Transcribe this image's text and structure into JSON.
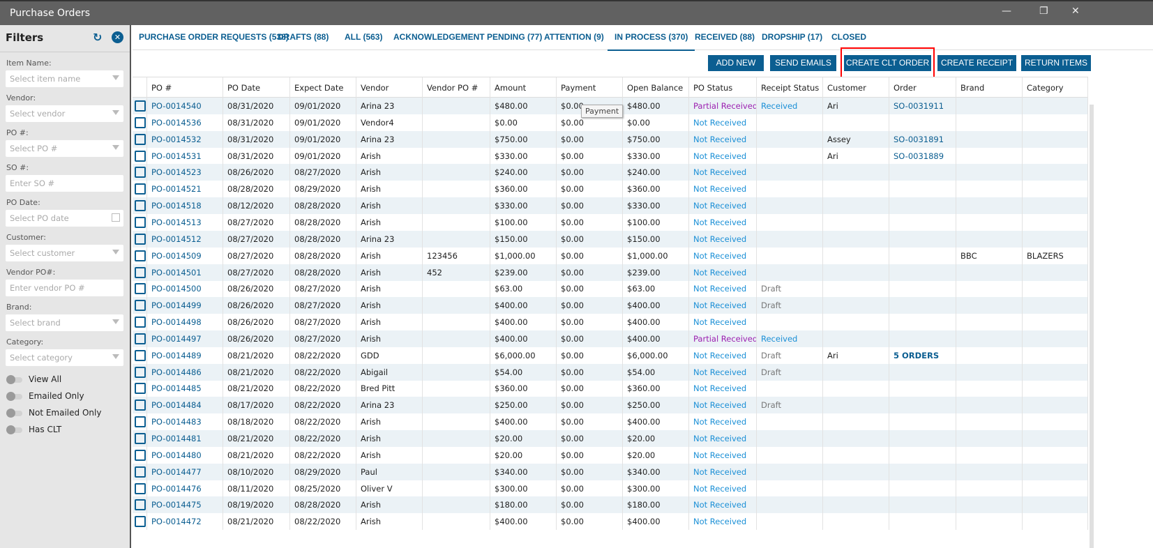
{
  "window": {
    "title": "Purchase Orders",
    "minimize": "—",
    "restore": "❐",
    "close": "✕"
  },
  "filters": {
    "title": "Filters",
    "refresh_icon": "↻",
    "clear_icon": "✕",
    "fields": [
      {
        "label": "Item Name:",
        "placeholder": "Select item name",
        "kind": "select"
      },
      {
        "label": "Vendor:",
        "placeholder": "Select vendor",
        "kind": "select"
      },
      {
        "label": "PO #:",
        "placeholder": "Select PO #",
        "kind": "select"
      },
      {
        "label": "SO #:",
        "placeholder": "Enter SO #",
        "kind": "text"
      },
      {
        "label": "PO Date:",
        "placeholder": "Select PO date",
        "kind": "date"
      },
      {
        "label": "Customer:",
        "placeholder": "Select customer",
        "kind": "select"
      },
      {
        "label": "Vendor PO#:",
        "placeholder": "Enter vendor PO #",
        "kind": "text"
      },
      {
        "label": "Brand:",
        "placeholder": "Select brand",
        "kind": "select"
      },
      {
        "label": "Category:",
        "placeholder": "Select category",
        "kind": "select"
      }
    ],
    "toggles": [
      "View All",
      "Emailed Only",
      "Not Emailed Only",
      "Has CLT"
    ]
  },
  "tabs": [
    "PURCHASE ORDER REQUESTS (538)",
    "DRAFTS (88)",
    "ALL (563)",
    "ACKNOWLEDGEMENT PENDING (77)",
    "ATTENTION (9)",
    "IN PROCESS (370)",
    "RECEIVED (88)",
    "DROPSHIP (17)",
    "CLOSED"
  ],
  "active_tab": 5,
  "buttons": [
    "ADD NEW",
    "SEND EMAILS",
    "CREATE CLT ORDER",
    "CREATE RECEIPT",
    "RETURN ITEMS"
  ],
  "tooltip": "Payment",
  "columns": [
    "PO #",
    "PO Date",
    "Expect Date",
    "Vendor",
    "Vendor PO #",
    "Amount",
    "Payment",
    "Open Balance",
    "PO Status",
    "Receipt Status",
    "Customer",
    "Order",
    "Brand",
    "Category"
  ],
  "rows": [
    [
      "PO-0014540",
      "08/31/2020",
      "09/01/2020",
      "Arina 23",
      "",
      "$480.00",
      "$0.00",
      "$480.00",
      "Partial Received",
      "Received",
      "Ari",
      "SO-0031911",
      "",
      ""
    ],
    [
      "PO-0014536",
      "08/31/2020",
      "09/01/2020",
      "Vendor4",
      "",
      "$0.00",
      "$0.00",
      "$0.00",
      "Not Received",
      "",
      "",
      "",
      "",
      ""
    ],
    [
      "PO-0014532",
      "08/31/2020",
      "09/01/2020",
      "Arina 23",
      "",
      "$750.00",
      "$0.00",
      "$750.00",
      "Not Received",
      "",
      "Assey",
      "SO-0031891",
      "",
      ""
    ],
    [
      "PO-0014531",
      "08/31/2020",
      "09/01/2020",
      "Arish",
      "",
      "$330.00",
      "$0.00",
      "$330.00",
      "Not Received",
      "",
      "Ari",
      "SO-0031889",
      "",
      ""
    ],
    [
      "PO-0014523",
      "08/26/2020",
      "08/27/2020",
      "Arish",
      "",
      "$240.00",
      "$0.00",
      "$240.00",
      "Not Received",
      "",
      "",
      "",
      "",
      ""
    ],
    [
      "PO-0014521",
      "08/28/2020",
      "08/29/2020",
      "Arish",
      "",
      "$360.00",
      "$0.00",
      "$360.00",
      "Not Received",
      "",
      "",
      "",
      "",
      ""
    ],
    [
      "PO-0014518",
      "08/12/2020",
      "08/28/2020",
      "Arish",
      "",
      "$330.00",
      "$0.00",
      "$330.00",
      "Not Received",
      "",
      "",
      "",
      "",
      ""
    ],
    [
      "PO-0014513",
      "08/27/2020",
      "08/28/2020",
      "Arish",
      "",
      "$100.00",
      "$0.00",
      "$100.00",
      "Not Received",
      "",
      "",
      "",
      "",
      ""
    ],
    [
      "PO-0014512",
      "08/27/2020",
      "08/28/2020",
      "Arina 23",
      "",
      "$150.00",
      "$0.00",
      "$150.00",
      "Not Received",
      "",
      "",
      "",
      "",
      ""
    ],
    [
      "PO-0014509",
      "08/27/2020",
      "08/28/2020",
      "Arish",
      "123456",
      "$1,000.00",
      "$0.00",
      "$1,000.00",
      "Not Received",
      "",
      "",
      "",
      "BBC",
      "BLAZERS"
    ],
    [
      "PO-0014501",
      "08/27/2020",
      "08/28/2020",
      "Arish",
      "452",
      "$239.00",
      "$0.00",
      "$239.00",
      "Not Received",
      "",
      "",
      "",
      "",
      ""
    ],
    [
      "PO-0014500",
      "08/26/2020",
      "08/27/2020",
      "Arish",
      "",
      "$63.00",
      "$0.00",
      "$63.00",
      "Not Received",
      "Draft",
      "",
      "",
      "",
      ""
    ],
    [
      "PO-0014499",
      "08/26/2020",
      "08/27/2020",
      "Arish",
      "",
      "$400.00",
      "$0.00",
      "$400.00",
      "Not Received",
      "Draft",
      "",
      "",
      "",
      ""
    ],
    [
      "PO-0014498",
      "08/26/2020",
      "08/27/2020",
      "Arish",
      "",
      "$400.00",
      "$0.00",
      "$400.00",
      "Not Received",
      "",
      "",
      "",
      "",
      ""
    ],
    [
      "PO-0014497",
      "08/26/2020",
      "08/27/2020",
      "Arish",
      "",
      "$400.00",
      "$0.00",
      "$400.00",
      "Partial Received",
      "Received",
      "",
      "",
      "",
      ""
    ],
    [
      "PO-0014489",
      "08/21/2020",
      "08/22/2020",
      "GDD",
      "",
      "$6,000.00",
      "$0.00",
      "$6,000.00",
      "Not Received",
      "Draft",
      "Ari",
      "5 ORDERS",
      "",
      ""
    ],
    [
      "PO-0014486",
      "08/21/2020",
      "08/22/2020",
      "Abigail",
      "",
      "$54.00",
      "$0.00",
      "$54.00",
      "Not Received",
      "Draft",
      "",
      "",
      "",
      ""
    ],
    [
      "PO-0014485",
      "08/21/2020",
      "08/22/2020",
      "Bred Pitt",
      "",
      "$360.00",
      "$0.00",
      "$360.00",
      "Not Received",
      "",
      "",
      "",
      "",
      ""
    ],
    [
      "PO-0014484",
      "08/17/2020",
      "08/22/2020",
      "Arina 23",
      "",
      "$250.00",
      "$0.00",
      "$250.00",
      "Not Received",
      "Draft",
      "",
      "",
      "",
      ""
    ],
    [
      "PO-0014483",
      "08/18/2020",
      "08/22/2020",
      "Arish",
      "",
      "$400.00",
      "$0.00",
      "$400.00",
      "Not Received",
      "",
      "",
      "",
      "",
      ""
    ],
    [
      "PO-0014481",
      "08/21/2020",
      "08/22/2020",
      "Arish",
      "",
      "$20.00",
      "$0.00",
      "$20.00",
      "Not Received",
      "",
      "",
      "",
      "",
      ""
    ],
    [
      "PO-0014480",
      "08/21/2020",
      "08/22/2020",
      "Arish",
      "",
      "$20.00",
      "$0.00",
      "$20.00",
      "Not Received",
      "",
      "",
      "",
      "",
      ""
    ],
    [
      "PO-0014477",
      "08/10/2020",
      "08/29/2020",
      "Paul",
      "",
      "$340.00",
      "$0.00",
      "$340.00",
      "Not Received",
      "",
      "",
      "",
      "",
      ""
    ],
    [
      "PO-0014476",
      "08/11/2020",
      "08/25/2020",
      "Oliver V",
      "",
      "$300.00",
      "$0.00",
      "$300.00",
      "Not Received",
      "",
      "",
      "",
      "",
      ""
    ],
    [
      "PO-0014475",
      "08/19/2020",
      "08/28/2020",
      "Arish",
      "",
      "$180.00",
      "$0.00",
      "$180.00",
      "Not Received",
      "",
      "",
      "",
      "",
      ""
    ],
    [
      "PO-0014472",
      "08/21/2020",
      "08/22/2020",
      "Arish",
      "",
      "$400.00",
      "$0.00",
      "$400.00",
      "Not Received",
      "",
      "",
      "",
      "",
      ""
    ]
  ],
  "colors": {
    "accent": "#0b5e91",
    "not_received": "#1a8fd6",
    "partial": "#9b1fb0",
    "highlight": "#ff0000"
  }
}
